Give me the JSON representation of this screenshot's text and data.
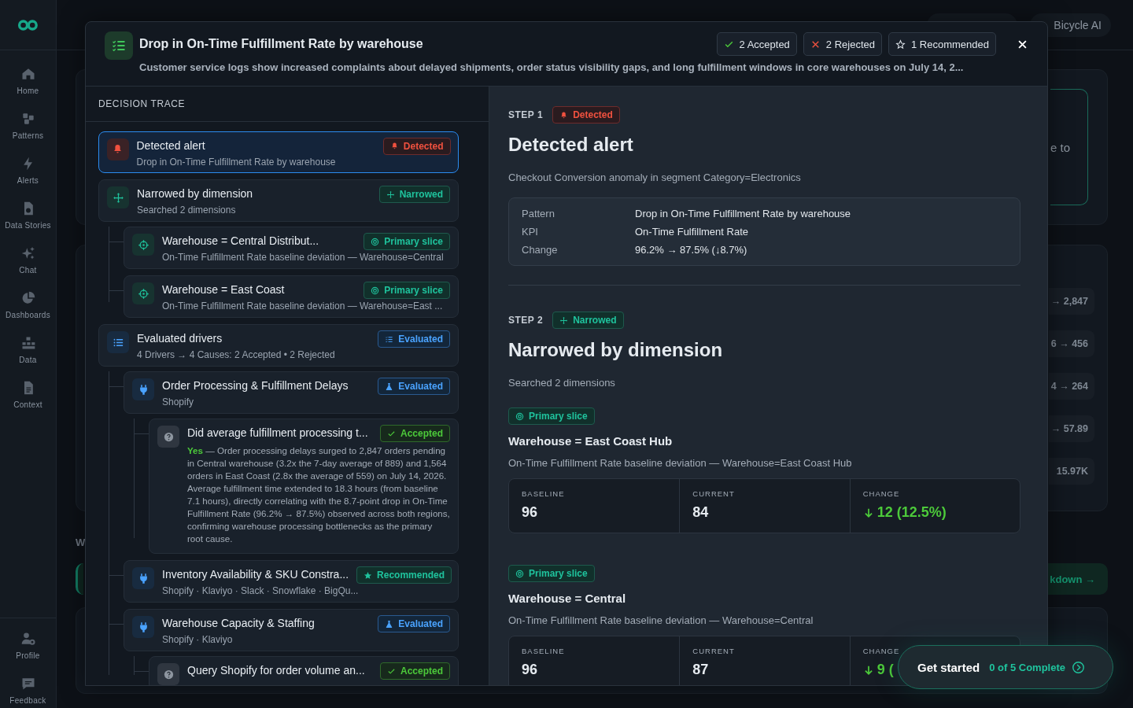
{
  "sidebar": {
    "items": [
      {
        "label": "Home"
      },
      {
        "label": "Patterns"
      },
      {
        "label": "Alerts"
      },
      {
        "label": "Data Stories"
      },
      {
        "label": "Chat"
      },
      {
        "label": "Dashboards"
      },
      {
        "label": "Data"
      },
      {
        "label": "Context"
      }
    ],
    "bottom_items": [
      {
        "label": "Profile"
      },
      {
        "label": "Feedback"
      }
    ]
  },
  "background": {
    "top_button": "Bicycle AI",
    "card_text": "e to",
    "rows": [
      "→ 2,847",
      "6 → 456",
      "4 → 264",
      "→ 57.89",
      "15.97K"
    ],
    "heading": "W",
    "link": "kdown →"
  },
  "modal": {
    "title": "Drop in On-Time Fulfillment Rate by warehouse",
    "summary": "Customer service logs show increased complaints about delayed shipments, order status visibility gaps, and long fulfillment windows in core warehouses on July 14, 2...",
    "counts": [
      {
        "kind": "accepted",
        "label": "2 Accepted"
      },
      {
        "kind": "rejected",
        "label": "2 Rejected"
      },
      {
        "kind": "recommended",
        "label": "1 Recommended"
      }
    ],
    "trace": {
      "heading": "DECISION TRACE",
      "items": [
        {
          "kind": "alert",
          "title": "Detected alert",
          "subtitle": "Drop in On-Time Fulfillment Rate by warehouse",
          "badge": {
            "kind": "detected",
            "label": "Detected"
          },
          "selected": true
        },
        {
          "kind": "dimension",
          "title": "Narrowed by dimension",
          "subtitle": "Searched 2 dimensions",
          "badge": {
            "kind": "narrowed",
            "label": "Narrowed"
          },
          "selected": false,
          "children": [
            {
              "kind": "slice",
              "title": "Warehouse = Central Distribut...",
              "subtitle": "On-Time Fulfillment Rate baseline deviation — Warehouse=Central",
              "badge": {
                "kind": "slice",
                "label": "Primary slice"
              },
              "selected": false
            },
            {
              "kind": "slice",
              "title": "Warehouse = East Coast",
              "subtitle": "On-Time Fulfillment Rate baseline deviation — Warehouse=East ...",
              "badge": {
                "kind": "slice",
                "label": "Primary slice"
              },
              "selected": false
            }
          ]
        },
        {
          "kind": "drivers",
          "title": "Evaluated drivers",
          "subtitle": "4 Drivers → 4 Causes: 2 Accepted • 2 Rejected",
          "badge": {
            "kind": "evaluated_list",
            "label": "Evaluated"
          },
          "selected": false,
          "children": [
            {
              "kind": "driver",
              "title": "Order Processing & Fulfillment Delays",
              "subtitle": "Shopify",
              "badge": {
                "kind": "evaluated",
                "label": "Evaluated"
              },
              "selected": false,
              "children": [
                {
                  "kind": "question",
                  "title": "Did average fulfillment processing t...",
                  "answer": "**Yes** — Order processing delays surged to 2,847 orders pending in Central warehouse (3.2x the 7-day average of 889) and 1,564 orders in East Coast (2.8x the average of 559) on July 14, 2026. Average fulfillment time extended to 18.3 hours (from baseline 7.1 hours), directly correlating with the 8.7-point drop in On-Time Fulfillment Rate (96.2% → 87.5%) observed across both regions, confirming warehouse processing bottlenecks as the primary root cause.",
                  "badge": {
                    "kind": "accepted",
                    "label": "Accepted"
                  },
                  "selected": false
                }
              ]
            },
            {
              "kind": "driver",
              "title": "Inventory Availability & SKU Constra...",
              "subtitle": "Shopify · Klaviyo · Slack · Snowflake · BigQu...",
              "badge": {
                "kind": "recommended",
                "label": "Recommended"
              },
              "selected": false
            },
            {
              "kind": "driver",
              "title": "Warehouse Capacity & Staffing",
              "subtitle": "Shopify · Klaviyo",
              "badge": {
                "kind": "evaluated",
                "label": "Evaluated"
              },
              "selected": false,
              "children": [
                {
                  "kind": "question",
                  "title": "Query Shopify for order volume an...",
                  "badge": {
                    "kind": "accepted",
                    "label": "Accepted"
                  },
                  "selected": false
                }
              ]
            }
          ]
        }
      ]
    },
    "steps": [
      {
        "step": "STEP 1",
        "badge": {
          "kind": "detected",
          "label": "Detected"
        },
        "title": "Detected alert",
        "description": "Checkout Conversion anomaly in segment Category=Electronics",
        "details": [
          {
            "label": "Pattern",
            "value": "Drop in On-Time Fulfillment Rate by warehouse"
          },
          {
            "label": "KPI",
            "value": "On-Time Fulfillment Rate"
          },
          {
            "label": "Change",
            "value": "96.2% → 87.5% (↓8.7%)"
          }
        ]
      },
      {
        "step": "STEP 2",
        "badge": {
          "kind": "narrowed",
          "label": "Narrowed"
        },
        "title": "Narrowed by dimension",
        "description": "Searched 2 dimensions",
        "slices": [
          {
            "badge": {
              "kind": "slice",
              "label": "Primary slice"
            },
            "title": "Warehouse = East Coast Hub",
            "description": "On-Time Fulfillment Rate baseline deviation — Warehouse=East Coast Hub",
            "metrics": [
              {
                "label": "BASELINE",
                "value": "96"
              },
              {
                "label": "CURRENT",
                "value": "84"
              },
              {
                "label": "CHANGE",
                "value": "12 (12.5%)",
                "kind": "decrease"
              }
            ]
          },
          {
            "badge": {
              "kind": "slice",
              "label": "Primary slice"
            },
            "title": "Warehouse = Central",
            "description": "On-Time Fulfillment Rate baseline deviation — Warehouse=Central",
            "metrics": [
              {
                "label": "BASELINE",
                "value": "96"
              },
              {
                "label": "CURRENT",
                "value": "87"
              },
              {
                "label": "CHANGE",
                "value": "9 (",
                "kind": "decrease"
              }
            ]
          }
        ]
      }
    ]
  },
  "get_started": {
    "label": "Get started",
    "progress": "0 of 5 Complete"
  }
}
